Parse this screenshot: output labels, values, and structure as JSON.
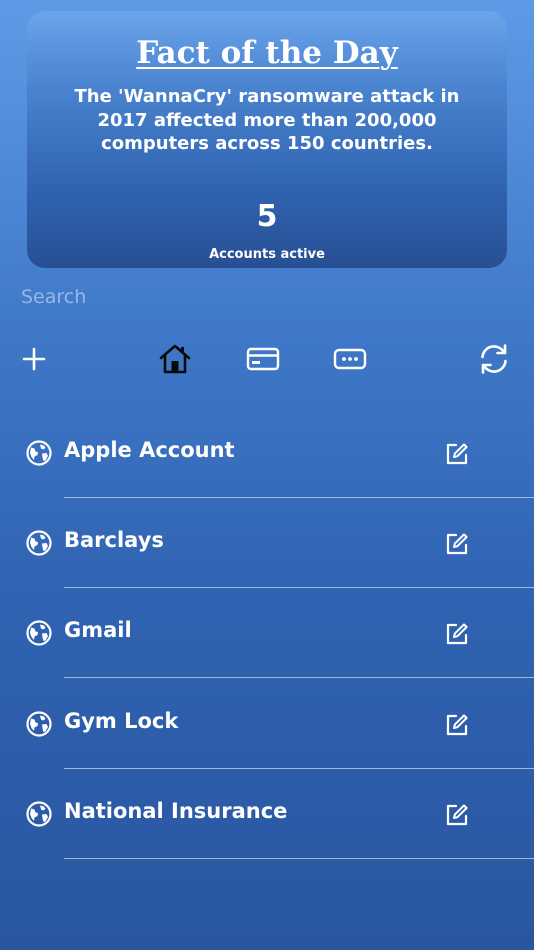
{
  "fact_card": {
    "title": "Fact of the Day",
    "text": "The 'WannaCry' ransomware attack in 2017 affected more than 200,000 computers across 150 countries.",
    "count": "5",
    "count_label": "Accounts active"
  },
  "search": {
    "placeholder": "Search",
    "value": ""
  },
  "toolbar": {
    "icons": [
      "plus-icon",
      "home-icon",
      "card-icon",
      "password-icon",
      "sync-icon"
    ],
    "active_icon": "home-icon"
  },
  "accounts": [
    {
      "name": "Apple Account",
      "icon": "globe-icon"
    },
    {
      "name": "Barclays",
      "icon": "globe-icon"
    },
    {
      "name": "Gmail",
      "icon": "globe-icon"
    },
    {
      "name": "Gym Lock",
      "icon": "globe-icon"
    },
    {
      "name": "National Insurance",
      "icon": "globe-icon"
    }
  ],
  "colors": {
    "background_top": "#5d9be6",
    "background_bottom": "#2a56a0",
    "text": "#ffffff",
    "active_icon": "#0a0a0a"
  }
}
